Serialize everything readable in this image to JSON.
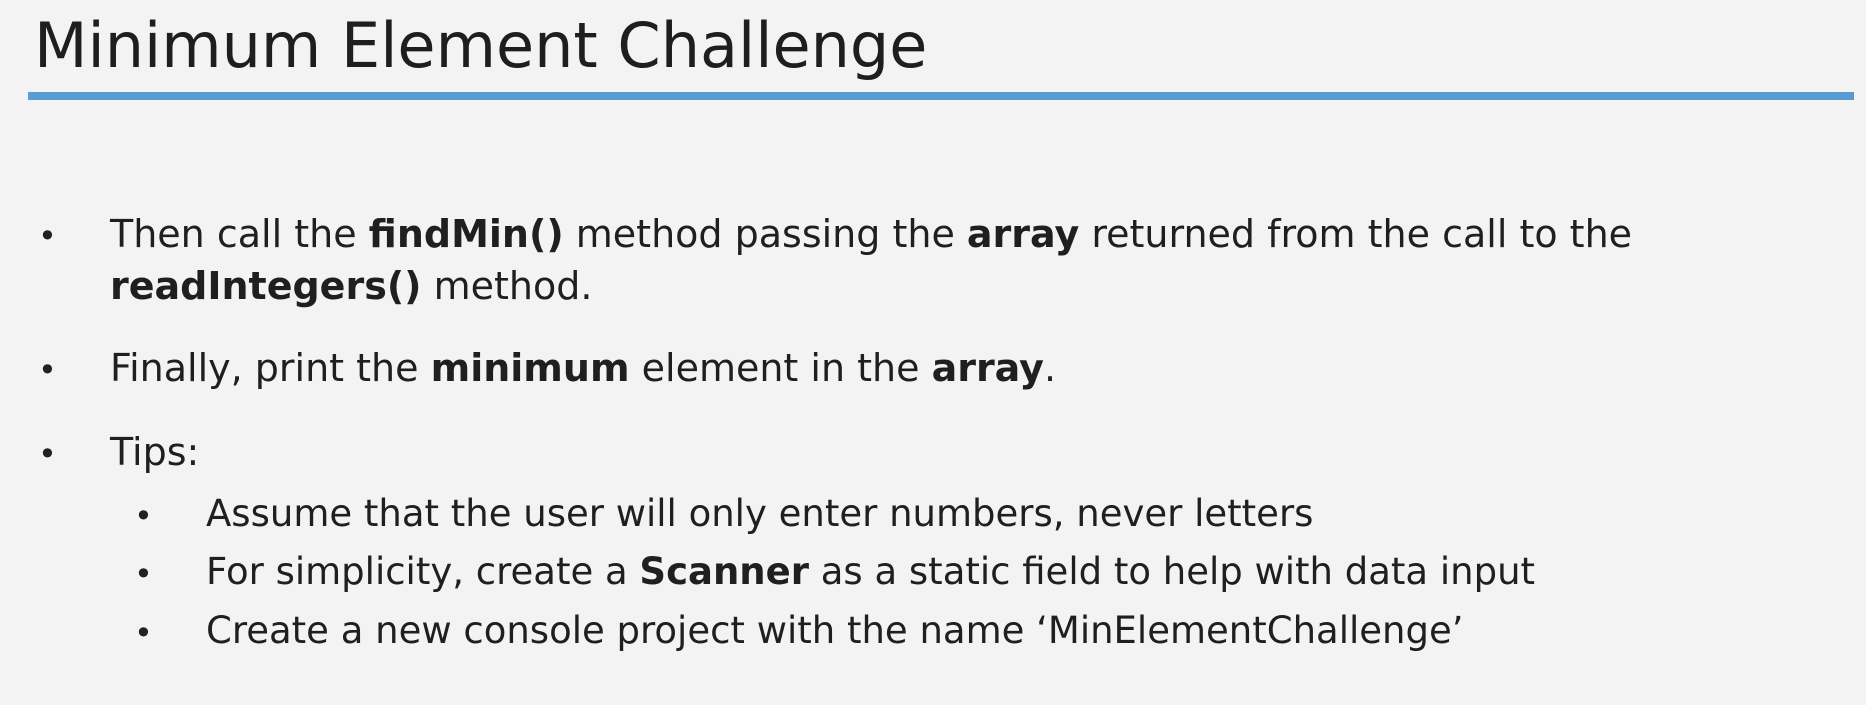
{
  "slide": {
    "title": "Minimum Element Challenge",
    "accent_color": "#5b9bd5",
    "bullet_glyph": "•"
  },
  "bullets": [
    {
      "line1": {
        "p1": "Then call the ",
        "b1": "findMin()",
        "p2": " method passing the ",
        "b2": "array",
        "p3": " returned from the call to the"
      },
      "line2": {
        "b1": "readIntegers()",
        "p1": " method."
      }
    },
    {
      "p1": "Finally, print the ",
      "b1": "minimum",
      "p2": " element in the ",
      "b2": "array",
      "p3": "."
    },
    {
      "text": "Tips:",
      "sub": [
        {
          "text": "Assume that the user will only enter numbers, never letters"
        },
        {
          "p1": "For simplicity, create a ",
          "b1": "Scanner",
          "p2": " as a static field to help with data input"
        },
        {
          "text": "Create a new console project with the name ‘MinElementChallenge’"
        }
      ]
    }
  ]
}
